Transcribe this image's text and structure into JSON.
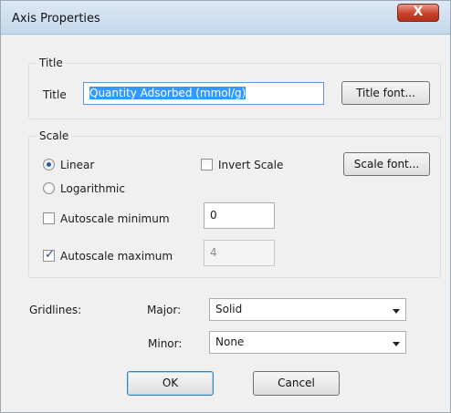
{
  "window": {
    "title": "Axis Properties",
    "close_glyph": "X"
  },
  "title_group": {
    "label": "Title",
    "field_label": "Title",
    "value": "Quantity Adsorbed (mmol/g)",
    "font_button": "Title font..."
  },
  "scale_group": {
    "label": "Scale",
    "linear": {
      "label": "Linear",
      "selected": true
    },
    "logarithmic": {
      "label": "Logarithmic",
      "selected": false
    },
    "invert": {
      "label": "Invert Scale",
      "checked": false
    },
    "font_button": "Scale font...",
    "autoscale_min": {
      "label": "Autoscale minimum",
      "checked": false,
      "value": "0"
    },
    "autoscale_max": {
      "label": "Autoscale maximum",
      "checked": true,
      "value": "4"
    }
  },
  "gridlines": {
    "label": "Gridlines:",
    "major_label": "Major:",
    "major_value": "Solid",
    "minor_label": "Minor:",
    "minor_value": "None"
  },
  "buttons": {
    "ok": "OK",
    "cancel": "Cancel"
  },
  "icons": {
    "close": "close-icon",
    "dropdown": "chevron-down-icon"
  }
}
